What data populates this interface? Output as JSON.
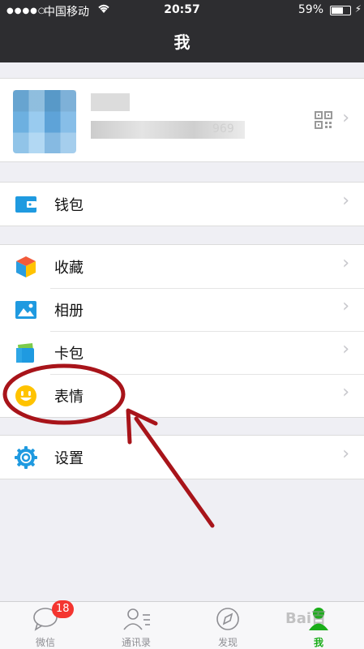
{
  "status_bar": {
    "signal_dots": "●●●●○",
    "carrier": "中国移动",
    "time": "20:57",
    "battery": "59%"
  },
  "header": {
    "title": "我"
  },
  "profile": {
    "blurred_number": "969"
  },
  "menu": {
    "wallet": "钱包",
    "favorites": "收藏",
    "album": "相册",
    "cards": "卡包",
    "stickers": "表情",
    "settings": "设置"
  },
  "tabs": [
    {
      "label": "微信",
      "badge": "18",
      "icon": "chat-bubble-icon"
    },
    {
      "label": "通讯录",
      "icon": "contacts-icon"
    },
    {
      "label": "发现",
      "icon": "compass-icon"
    },
    {
      "label": "我",
      "icon": "person-icon"
    }
  ],
  "colors": {
    "header_bg": "#2d2d30",
    "accent_green": "#1aad19",
    "badge_red": "#f43530",
    "annotation_red": "#a8141a",
    "icon_blue": "#1f9ae0",
    "sticker_yellow": "#ffc300"
  },
  "watermark": "Bai百"
}
